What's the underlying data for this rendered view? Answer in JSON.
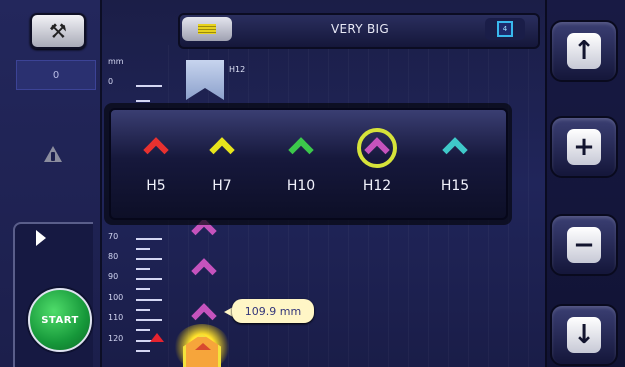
{
  "toolbar": {
    "tools_icon": "wrench-screwdriver-icon",
    "mode_icon": "tape-icon",
    "size_label": "VERY BIG",
    "info_icon": "4"
  },
  "left_panel": {
    "counter_value": "0",
    "warning_icon": "warning-triangle-icon",
    "play_icon": "play-icon",
    "start_label": "START"
  },
  "ruler": {
    "unit": "mm",
    "labels": [
      "0",
      "70",
      "80",
      "90",
      "100",
      "110",
      "120"
    ]
  },
  "marker": {
    "flag_label": "H12",
    "measurement": "109.9 mm"
  },
  "popup": {
    "options": [
      {
        "label": "H5",
        "color": "#e8312f"
      },
      {
        "label": "H7",
        "color": "#e7e41c"
      },
      {
        "label": "H10",
        "color": "#3cc84b"
      },
      {
        "label": "H12",
        "color": "#c553bd",
        "selected": true
      },
      {
        "label": "H15",
        "color": "#3fc9c9"
      }
    ]
  },
  "right_panel": {
    "up_icon": "arrow-up-icon",
    "plus_icon": "plus-icon",
    "minus_icon": "minus-icon",
    "down_icon": "arrow-down-icon"
  }
}
